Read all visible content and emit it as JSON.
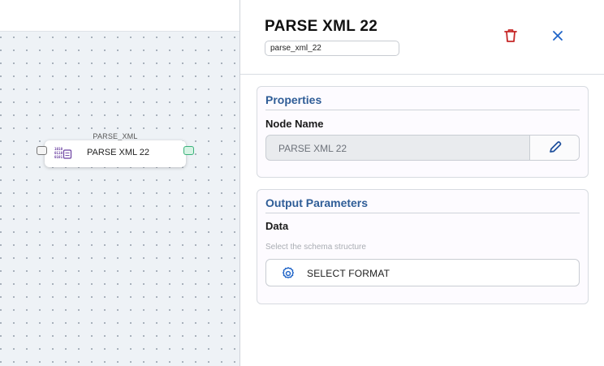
{
  "canvas": {
    "node": {
      "type_label": "PARSE_XML",
      "label": "PARSE XML 22"
    }
  },
  "panel": {
    "title": "PARSE XML 22",
    "slug": "parse_xml_22",
    "properties": {
      "title": "Properties",
      "node_name_label": "Node Name",
      "node_name_value": "PARSE XML 22"
    },
    "output": {
      "title": "Output Parameters",
      "data_label": "Data",
      "hint": "Select the schema structure",
      "select_format_label": "SELECT FORMAT"
    }
  },
  "colors": {
    "accent": "#2f5d97",
    "delete": "#c62828",
    "close": "#1e63c7",
    "connector": "#38b27a",
    "node_icon": "#6a3fa0"
  }
}
